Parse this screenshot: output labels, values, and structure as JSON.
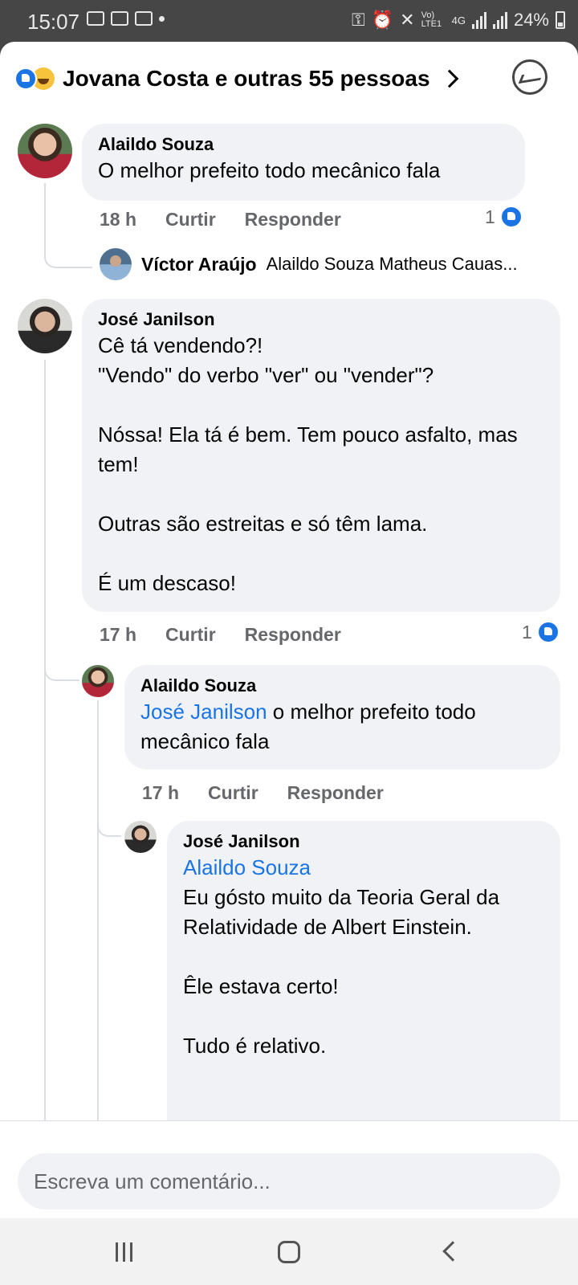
{
  "status_bar": {
    "time": "15:07",
    "battery": "24%",
    "network": "4G",
    "volte": "Vo) LTE1"
  },
  "header": {
    "reactions_text": "Jovana Costa e outras 55 pessoas",
    "reaction_icons": [
      "like-icon",
      "haha-icon"
    ]
  },
  "comments": [
    {
      "author": "Alaildo Souza",
      "text": "O melhor prefeito todo mecânico fala",
      "time": "18 h",
      "like_label": "Curtir",
      "reply_label": "Responder",
      "likes": "1",
      "reply_summary": {
        "author": "Víctor Araújo",
        "text": "Alaildo Souza Matheus Cauas..."
      }
    },
    {
      "author": "José Janilson",
      "text": "Cê tá vendendo?!\n\"Vendo\" do verbo \"ver\" ou \"vender\"?\n\nNóssa! Ela tá é bem. Tem pouco asfalto, mas tem!\n\nOutras são estreitas e só têm lama.\n\nÉ um descaso!",
      "time": "17 h",
      "like_label": "Curtir",
      "reply_label": "Responder",
      "likes": "1",
      "replies": [
        {
          "author": "Alaildo Souza",
          "mention": "José Janilson",
          "text": " o melhor prefeito todo mecânico fala",
          "time": "17 h",
          "like_label": "Curtir",
          "reply_label": "Responder"
        },
        {
          "author": "José Janilson",
          "mention": "Alaildo Souza",
          "text": "Eu gósto muito da Teoria Geral da Relatividade de Albert Einstein.\n\nÊle estava certo!\n\nTudo é relativo."
        }
      ]
    }
  ],
  "composer": {
    "placeholder": "Escreva um comentário..."
  },
  "colors": {
    "accent": "#1b74e4",
    "bubble": "#f0f2f5",
    "meta": "#65676b"
  }
}
